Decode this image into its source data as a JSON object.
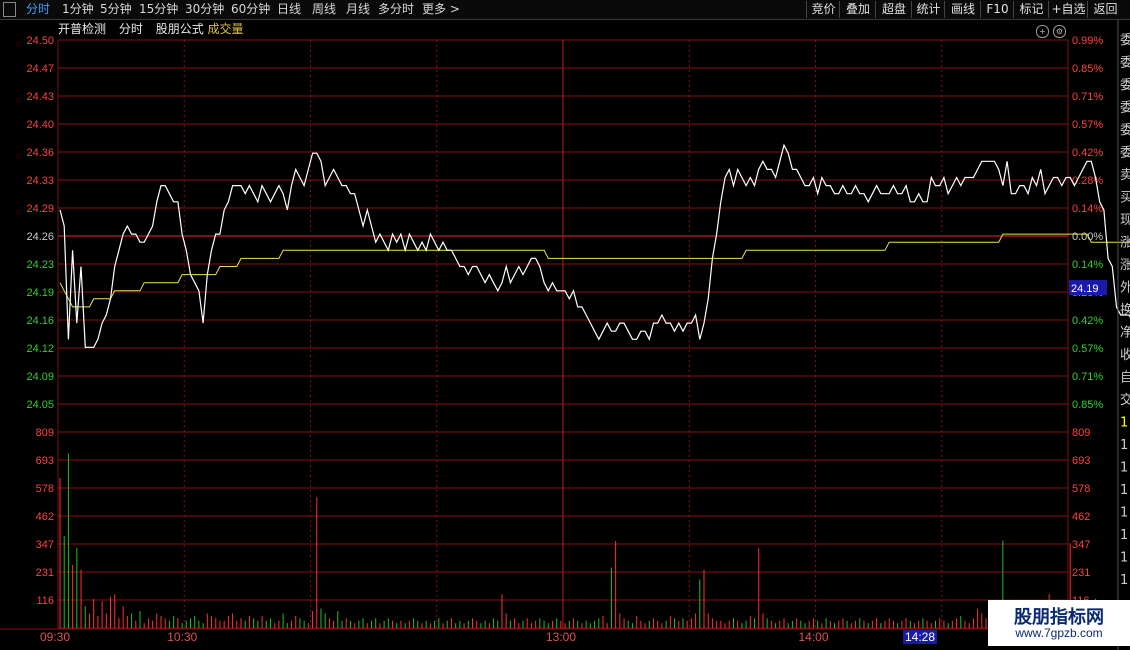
{
  "toolbar": {
    "menu_icon": "menu-icon",
    "tabs": [
      "分时",
      "1分钟",
      "5分钟",
      "15分钟",
      "30分钟",
      "60分钟",
      "日线",
      "周线",
      "月线",
      "多分时",
      "更多"
    ],
    "right_buttons": [
      "竞价",
      "叠加",
      "超盘",
      "统计",
      "画线",
      "F10",
      "标记",
      "+自选",
      "返回"
    ]
  },
  "chart_title": {
    "name": "开普检测",
    "mode": "分时",
    "formula": "股朋公式",
    "volume": "成交量"
  },
  "header_icons": [
    "plus-circle-icon",
    "gear-circle-icon"
  ],
  "current_price_label": "24.19",
  "current_time_label": "14:28",
  "watermark": {
    "line1": "股朋指标网",
    "line2": "www.7gpzb.com"
  },
  "right_panel_chars": [
    "委",
    "委",
    "委",
    "委",
    "委",
    "委",
    "卖",
    "买",
    "现",
    "涨",
    "涨",
    "外",
    "换",
    "净",
    "收",
    "自",
    "交",
    "1",
    "1",
    "1",
    "1",
    "1",
    "1",
    "1",
    "1"
  ],
  "colors": {
    "up": "#ff3030",
    "down": "#20c020",
    "price_line": "#ffffff",
    "avg_line": "#e6e64a",
    "grid": "#8a1010",
    "axis_text": "#e05050"
  },
  "chart_data": {
    "type": "line",
    "price_axis": {
      "ticks": [
        "24.50",
        "24.47",
        "24.43",
        "24.40",
        "24.36",
        "24.33",
        "24.29",
        "24.26",
        "24.23",
        "24.19",
        "24.16",
        "24.12",
        "24.09",
        "24.05"
      ],
      "pct_ticks": [
        "0.99%",
        "0.85%",
        "0.71%",
        "0.57%",
        "0.42%",
        "0.28%",
        "0.14%",
        "0.00%",
        "0.14%",
        "0.28%",
        "0.42%",
        "0.57%",
        "0.71%",
        "0.85%"
      ],
      "prev_close": 24.26,
      "ylim": [
        24.05,
        24.5
      ]
    },
    "volume_axis": {
      "ticks": [
        "809",
        "693",
        "578",
        "462",
        "347",
        "231",
        "116"
      ],
      "ylim": [
        0,
        809
      ]
    },
    "time_labels": [
      "09:30",
      "10:30",
      "13:00",
      "14:00"
    ],
    "total_minutes": 240,
    "price": [
      24.29,
      24.27,
      24.13,
      24.24,
      24.15,
      24.22,
      24.12,
      24.12,
      24.12,
      24.13,
      24.15,
      24.16,
      24.18,
      24.22,
      24.24,
      24.26,
      24.27,
      24.26,
      24.26,
      24.25,
      24.25,
      24.26,
      24.27,
      24.3,
      24.32,
      24.32,
      24.31,
      24.3,
      24.3,
      24.26,
      24.24,
      24.21,
      24.2,
      24.19,
      24.15,
      24.21,
      24.24,
      24.26,
      24.26,
      24.29,
      24.3,
      24.32,
      24.32,
      24.32,
      24.31,
      24.32,
      24.31,
      24.3,
      24.32,
      24.31,
      24.3,
      24.31,
      24.32,
      24.31,
      24.29,
      24.32,
      24.34,
      24.33,
      24.32,
      24.34,
      24.36,
      24.36,
      24.35,
      24.32,
      24.33,
      24.34,
      24.33,
      24.32,
      24.32,
      24.31,
      24.31,
      24.29,
      24.27,
      24.29,
      24.27,
      24.25,
      24.26,
      24.25,
      24.24,
      24.26,
      24.25,
      24.26,
      24.24,
      24.26,
      24.25,
      24.24,
      24.25,
      24.24,
      24.26,
      24.25,
      24.24,
      24.25,
      24.24,
      24.24,
      24.23,
      24.22,
      24.22,
      24.21,
      24.22,
      24.22,
      24.21,
      24.2,
      24.21,
      24.2,
      24.19,
      24.2,
      24.22,
      24.2,
      24.21,
      24.22,
      24.21,
      24.22,
      24.23,
      24.23,
      24.22,
      24.2,
      24.19,
      24.2,
      24.19,
      24.19,
      24.19,
      24.18,
      24.19,
      24.17,
      24.17,
      24.16,
      24.15,
      24.14,
      24.13,
      24.14,
      24.15,
      24.14,
      24.14,
      24.15,
      24.15,
      24.14,
      24.13,
      24.13,
      24.14,
      24.14,
      24.13,
      24.15,
      24.15,
      24.16,
      24.15,
      24.15,
      24.14,
      24.15,
      24.14,
      24.15,
      24.15,
      24.16,
      24.13,
      24.15,
      24.18,
      24.23,
      24.26,
      24.3,
      24.33,
      24.34,
      24.32,
      24.34,
      24.33,
      24.32,
      24.33,
      24.32,
      24.34,
      24.35,
      24.34,
      24.34,
      24.33,
      24.35,
      24.37,
      24.36,
      24.34,
      24.34,
      24.33,
      24.32,
      24.32,
      24.33,
      24.31,
      24.33,
      24.32,
      24.32,
      24.31,
      24.31,
      24.32,
      24.31,
      24.31,
      24.32,
      24.31,
      24.31,
      24.3,
      24.31,
      24.32,
      24.31,
      24.31,
      24.31,
      24.32,
      24.31,
      24.31,
      24.32,
      24.3,
      24.3,
      24.31,
      24.3,
      24.3,
      24.33,
      24.32,
      24.32,
      24.33,
      24.31,
      24.32,
      24.33,
      24.32,
      24.33,
      24.33,
      24.33,
      24.34,
      24.35,
      24.35,
      24.35,
      24.35,
      24.34,
      24.32,
      24.35,
      24.31,
      24.31,
      24.32,
      24.32,
      24.31,
      24.33,
      24.32,
      24.34,
      24.31,
      24.32,
      24.33,
      24.33,
      24.32,
      24.33,
      24.33,
      24.32,
      24.33,
      24.34,
      24.35,
      24.35,
      24.33,
      24.3,
      24.29,
      24.23,
      24.22,
      24.17,
      24.16,
      24.16,
      24.16,
      24.15,
      24.17,
      24.17,
      24.17,
      24.17,
      24.17,
      24.16,
      24.16
    ],
    "avg_price": [
      24.2,
      24.19,
      24.18,
      24.17,
      24.17,
      24.17,
      24.17,
      24.17,
      24.18,
      24.18,
      24.18,
      24.18,
      24.18,
      24.19,
      24.19,
      24.19,
      24.19,
      24.19,
      24.19,
      24.19,
      24.2,
      24.2,
      24.2,
      24.2,
      24.2,
      24.2,
      24.2,
      24.2,
      24.2,
      24.21,
      24.21,
      24.21,
      24.21,
      24.21,
      24.21,
      24.21,
      24.21,
      24.21,
      24.22,
      24.22,
      24.22,
      24.22,
      24.22,
      24.23,
      24.23,
      24.23,
      24.23,
      24.23,
      24.23,
      24.23,
      24.23,
      24.23,
      24.23,
      24.24,
      24.24,
      24.24,
      24.24,
      24.24,
      24.24,
      24.24,
      24.24,
      24.24,
      24.24,
      24.24,
      24.24,
      24.24,
      24.24,
      24.24,
      24.24,
      24.24,
      24.24,
      24.24,
      24.24,
      24.24,
      24.24,
      24.24,
      24.24,
      24.24,
      24.24,
      24.24,
      24.24,
      24.24,
      24.24,
      24.24,
      24.24,
      24.24,
      24.24,
      24.24,
      24.24,
      24.24,
      24.24,
      24.24,
      24.24,
      24.24,
      24.24,
      24.24,
      24.24,
      24.24,
      24.24,
      24.24,
      24.24,
      24.24,
      24.24,
      24.24,
      24.24,
      24.24,
      24.24,
      24.24,
      24.24,
      24.24,
      24.24,
      24.24,
      24.24,
      24.24,
      24.24,
      24.24,
      24.23,
      24.23,
      24.23,
      24.23,
      24.23,
      24.23,
      24.23,
      24.23,
      24.23,
      24.23,
      24.23,
      24.23,
      24.23,
      24.23,
      24.23,
      24.23,
      24.23,
      24.23,
      24.23,
      24.23,
      24.23,
      24.23,
      24.23,
      24.23,
      24.23,
      24.23,
      24.23,
      24.23,
      24.23,
      24.23,
      24.23,
      24.23,
      24.23,
      24.23,
      24.23,
      24.23,
      24.23,
      24.23,
      24.23,
      24.23,
      24.23,
      24.23,
      24.23,
      24.23,
      24.23,
      24.23,
      24.23,
      24.24,
      24.24,
      24.24,
      24.24,
      24.24,
      24.24,
      24.24,
      24.24,
      24.24,
      24.24,
      24.24,
      24.24,
      24.24,
      24.24,
      24.24,
      24.24,
      24.24,
      24.24,
      24.24,
      24.24,
      24.24,
      24.24,
      24.24,
      24.24,
      24.24,
      24.24,
      24.24,
      24.24,
      24.24,
      24.24,
      24.24,
      24.24,
      24.24,
      24.24,
      24.25,
      24.25,
      24.25,
      24.25,
      24.25,
      24.25,
      24.25,
      24.25,
      24.25,
      24.25,
      24.25,
      24.25,
      24.25,
      24.25,
      24.25,
      24.25,
      24.25,
      24.25,
      24.25,
      24.25,
      24.25,
      24.25,
      24.25,
      24.25,
      24.25,
      24.25,
      24.25,
      24.26,
      24.26,
      24.26,
      24.26,
      24.26,
      24.26,
      24.26,
      24.26,
      24.26,
      24.26,
      24.26,
      24.26,
      24.26,
      24.26,
      24.26,
      24.26,
      24.26,
      24.26,
      24.26,
      24.26,
      24.26,
      24.25,
      24.25,
      24.25,
      24.25,
      24.25,
      24.25,
      24.25,
      24.25,
      24.25,
      24.25,
      24.25
    ],
    "volume": [
      620,
      380,
      720,
      260,
      330,
      240,
      90,
      60,
      120,
      50,
      110,
      60,
      130,
      140,
      40,
      90,
      50,
      60,
      30,
      70,
      20,
      40,
      30,
      60,
      50,
      40,
      30,
      50,
      40,
      20,
      30,
      40,
      50,
      30,
      20,
      60,
      50,
      40,
      30,
      30,
      50,
      60,
      30,
      40,
      30,
      50,
      40,
      30,
      50,
      30,
      40,
      20,
      30,
      60,
      20,
      30,
      50,
      40,
      30,
      20,
      70,
      540,
      80,
      60,
      40,
      30,
      70,
      30,
      40,
      30,
      20,
      30,
      40,
      20,
      30,
      40,
      20,
      30,
      40,
      30,
      20,
      30,
      20,
      30,
      40,
      30,
      20,
      30,
      20,
      30,
      40,
      20,
      30,
      40,
      20,
      30,
      20,
      30,
      40,
      30,
      20,
      30,
      20,
      40,
      30,
      140,
      60,
      30,
      40,
      20,
      30,
      40,
      20,
      30,
      40,
      30,
      20,
      30,
      40,
      30,
      20,
      30,
      40,
      30,
      20,
      30,
      20,
      30,
      40,
      50,
      20,
      250,
      360,
      60,
      40,
      30,
      20,
      50,
      30,
      20,
      30,
      40,
      30,
      20,
      30,
      50,
      40,
      30,
      40,
      30,
      40,
      60,
      200,
      240,
      60,
      40,
      30,
      30,
      20,
      30,
      40,
      30,
      20,
      30,
      50,
      40,
      330,
      60,
      40,
      30,
      20,
      30,
      40,
      20,
      30,
      40,
      30,
      20,
      30,
      40,
      30,
      20,
      40,
      30,
      20,
      30,
      40,
      30,
      20,
      30,
      40,
      30,
      20,
      30,
      40,
      20,
      30,
      40,
      30,
      20,
      30,
      40,
      30,
      20,
      30,
      40,
      30,
      20,
      30,
      40,
      30,
      20,
      30,
      40,
      50,
      30,
      20,
      40,
      80,
      60,
      40,
      50,
      30,
      60,
      360,
      70,
      40,
      30,
      80,
      40,
      30,
      90,
      60,
      50,
      30,
      140,
      90,
      60,
      30,
      40,
      350,
      80,
      40,
      30,
      50,
      60,
      120,
      40,
      30,
      90,
      70,
      50,
      20,
      30,
      30,
      60,
      170,
      80,
      190,
      60,
      120,
      30,
      80,
      30,
      40
    ]
  }
}
